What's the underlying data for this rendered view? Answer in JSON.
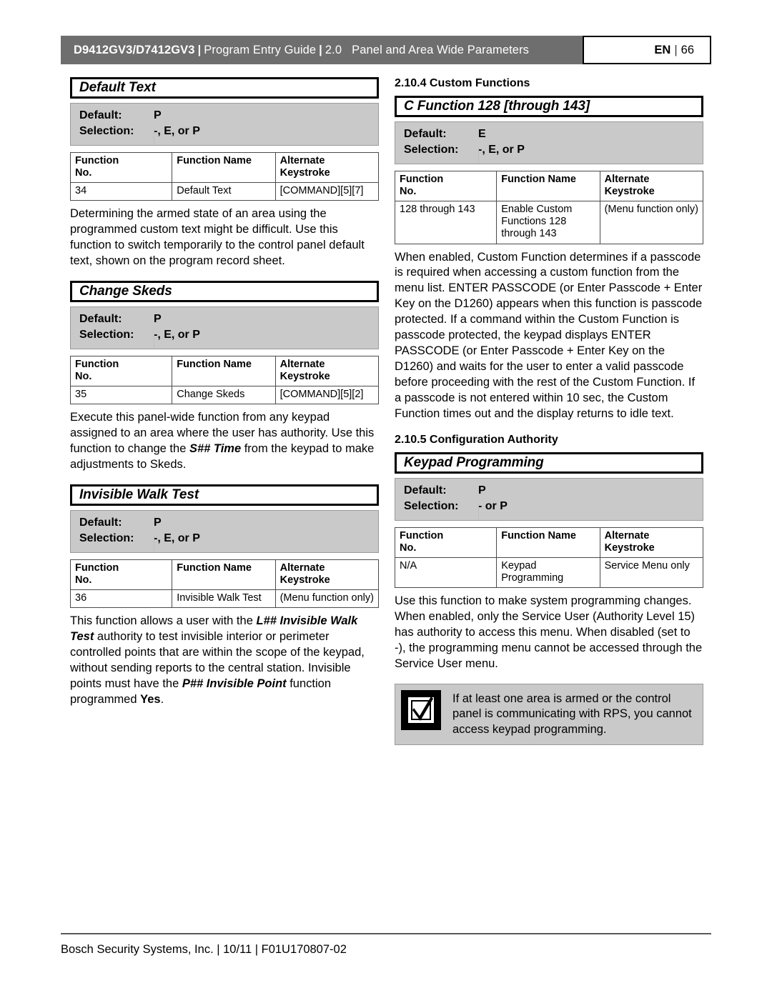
{
  "header": {
    "product": "D9412GV3/D7412GV3",
    "sep": "|",
    "guide": "Program Entry Guide",
    "version": "2.0",
    "section": "Panel and Area Wide Parameters",
    "lang_code": "EN",
    "lang_sep": "|",
    "page_number": "66"
  },
  "table_headers": {
    "function_no": "Function No.",
    "function_no_line1": "Function",
    "function_no_line2": "No.",
    "function_name": "Function Name",
    "alternate_keystroke_line1": "Alternate",
    "alternate_keystroke_line2": "Keystroke"
  },
  "labels": {
    "default": "Default:",
    "selection": "Selection:"
  },
  "left_column": {
    "sections": [
      {
        "title": "Default Text",
        "default": "P",
        "selection": "-, E, or P",
        "row": {
          "function_no": "34",
          "function_name": "Default Text",
          "alternate_keystroke": "[COMMAND][5][7]"
        },
        "body": "Determining the armed state of an area using the programmed custom text might be difficult. Use this function to switch temporarily to the control panel default text, shown on the program record sheet."
      },
      {
        "title": "Change Skeds",
        "default": "P",
        "selection": "-, E, or P",
        "row": {
          "function_no": "35",
          "function_name": "Change Skeds",
          "alternate_keystroke": "[COMMAND][5][2]"
        },
        "body_part1": "Execute this panel-wide function from any keypad assigned to an area where the user has authority. Use this function to change the ",
        "body_emph1": "S## Time",
        "body_part2": " from the keypad to make adjustments to Skeds."
      },
      {
        "title": "Invisible Walk Test",
        "default": "P",
        "selection": "-, E, or P",
        "row": {
          "function_no": "36",
          "function_name": "Invisible Walk Test",
          "alternate_keystroke": "(Menu function only)"
        },
        "body_part1": "This function allows a user with the ",
        "body_emph1": "L## Invisible Walk Test",
        "body_part2": " authority to test invisible interior or perimeter controlled points that are within the scope of the keypad, without sending reports to the central station. Invisible points must have the ",
        "body_emph2": "P## Invisible Point",
        "body_part3": " function programmed ",
        "body_bold3": "Yes",
        "body_part4": "."
      }
    ]
  },
  "right_column": {
    "subhead_custom_functions": "2.10.4 Custom Functions",
    "subhead_configuration_authority": "2.10.5 Configuration Authority",
    "sections": [
      {
        "title": "C Function 128 [through 143]",
        "default": "E",
        "selection": "-, E, or P",
        "row": {
          "function_no": "128 through 143",
          "function_name": "Enable Custom Functions 128 through 143",
          "alternate_keystroke": "(Menu function only)"
        },
        "body": "When enabled, Custom Function determines if a passcode is required when accessing a custom function from the menu list. ENTER PASSCODE (or Enter Passcode + Enter Key on the D1260) appears when this function is passcode protected. If a command within the Custom Function is passcode protected, the keypad displays ENTER PASSCODE (or Enter Passcode + Enter Key on the D1260) and waits for the user to enter a valid passcode before proceeding with the rest of the Custom Function. If a passcode is not entered within 10 sec, the Custom Function times out and the display returns to idle text."
      },
      {
        "title": "Keypad Programming",
        "default": "P",
        "selection": "- or P",
        "row": {
          "function_no": "N/A",
          "function_name": "Keypad Programming",
          "alternate_keystroke": "Service Menu only"
        },
        "body": "Use this function to make system programming changes. When enabled, only the Service User (Authority Level 15) has authority to access this menu. When disabled (set to -), the programming menu cannot be accessed through the Service User menu."
      }
    ],
    "notice": {
      "icon": "checkbox-checked-icon",
      "text": "If at least one area is armed or the control panel is communicating with RPS, you cannot access keypad programming."
    }
  },
  "footer": {
    "text": "Bosch Security Systems, Inc. | 10/11 | F01U170807-02"
  },
  "colors": {
    "header_bar": "#6e6e6e",
    "param_box": "#c9c9c9",
    "notice_box": "#c9c9c9",
    "rule": "#5a5a5a"
  }
}
